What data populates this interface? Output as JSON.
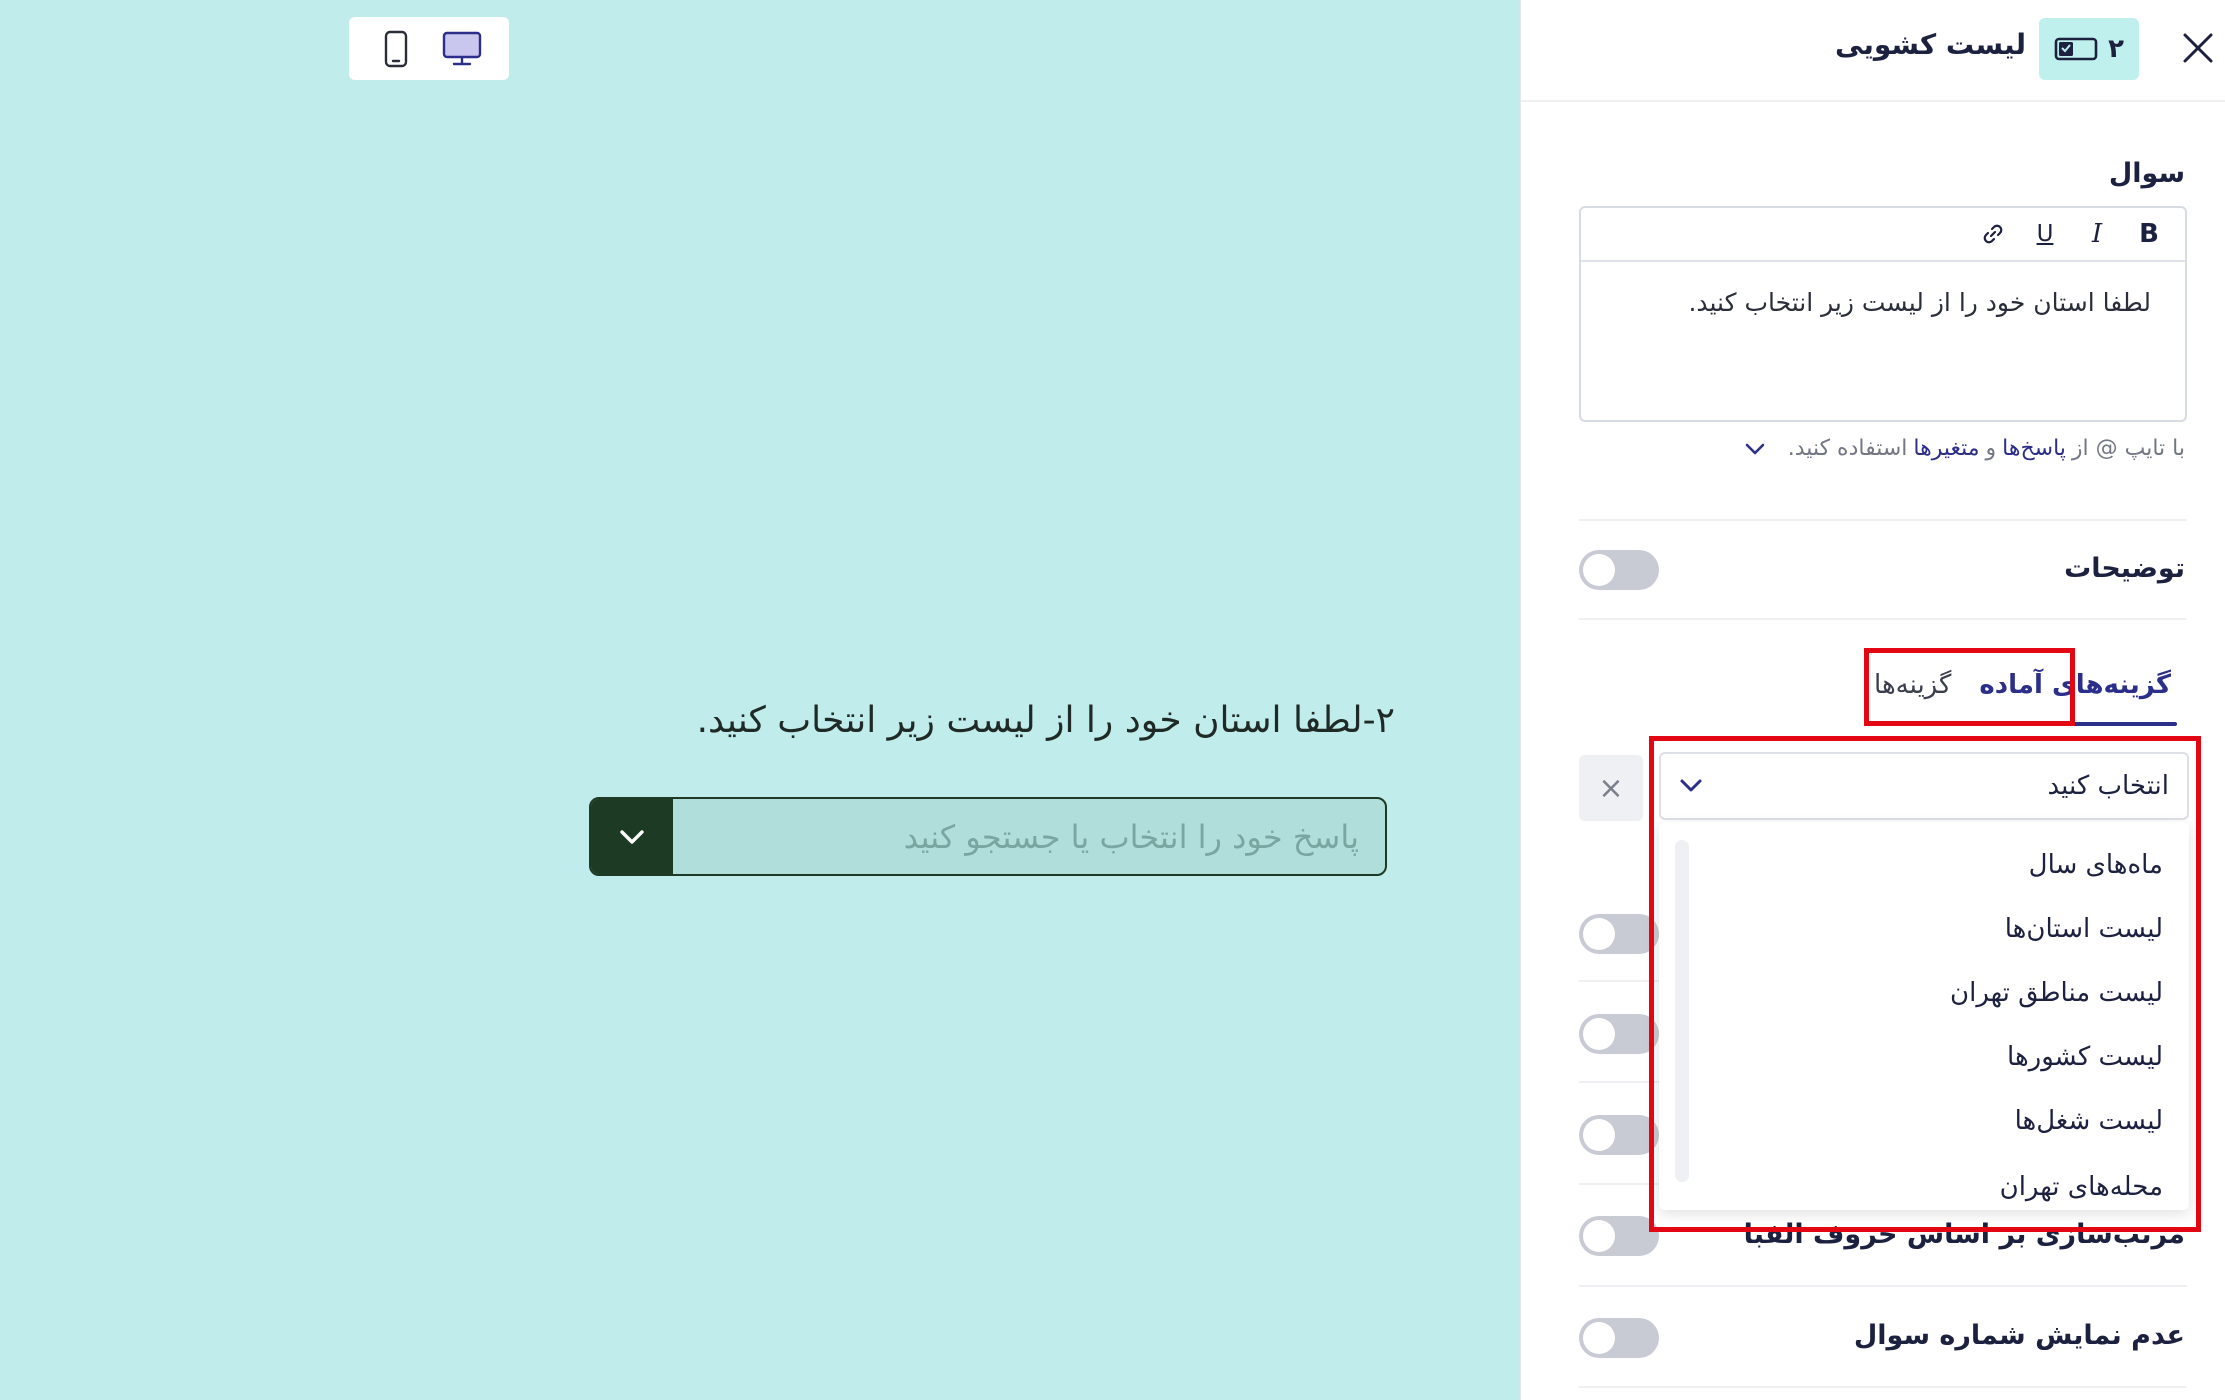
{
  "preview": {
    "question_number": "۲-",
    "question_text": "لطفا استان خود را از لیست زیر انتخاب کنید.",
    "answer_placeholder": "پاسخ خود را انتخاب یا جستجو کنید",
    "device_modes": [
      "desktop-icon",
      "mobile-icon"
    ],
    "colors": {
      "background": "#c0ecec",
      "accent": "#1c3a24"
    }
  },
  "panel": {
    "title": "لیست کشویی",
    "badge_number": "۲",
    "question_label": "سوال",
    "toolbar": {
      "bold": "B",
      "italic": "I",
      "underline": "U"
    },
    "question_body": "لطفا استان خود را از لیست زیر انتخاب کنید.",
    "hint": {
      "prefix": "با تایپ @ از",
      "link1": "پاسخ‌ها",
      "conj": "و",
      "link2": "متغیرها",
      "suffix": "استفاده کنید."
    },
    "description_label": "توضیحات",
    "tabs": [
      {
        "label": "گزینه‌ها"
      },
      {
        "label": "گزینه‌های آماده"
      }
    ],
    "active_tab": "گزینه‌های آماده",
    "select": {
      "value": "انتخاب کنید",
      "clear": "×",
      "options": [
        "ماه‌های سال",
        "لیست استان‌ها",
        "لیست مناطق تهران",
        "لیست کشورها",
        "لیست شغل‌ها",
        "محله‌های تهران"
      ]
    },
    "toggle_labels": {
      "sort_alphabetical": "مرتب‌سازی بر اساس حروف الفبا",
      "hide_question_number": "عدم نمایش شماره سوال"
    },
    "colors": {
      "primary": "#2c2f8a",
      "badge_bg": "#bff0ee",
      "highlight": "#e30613"
    }
  }
}
